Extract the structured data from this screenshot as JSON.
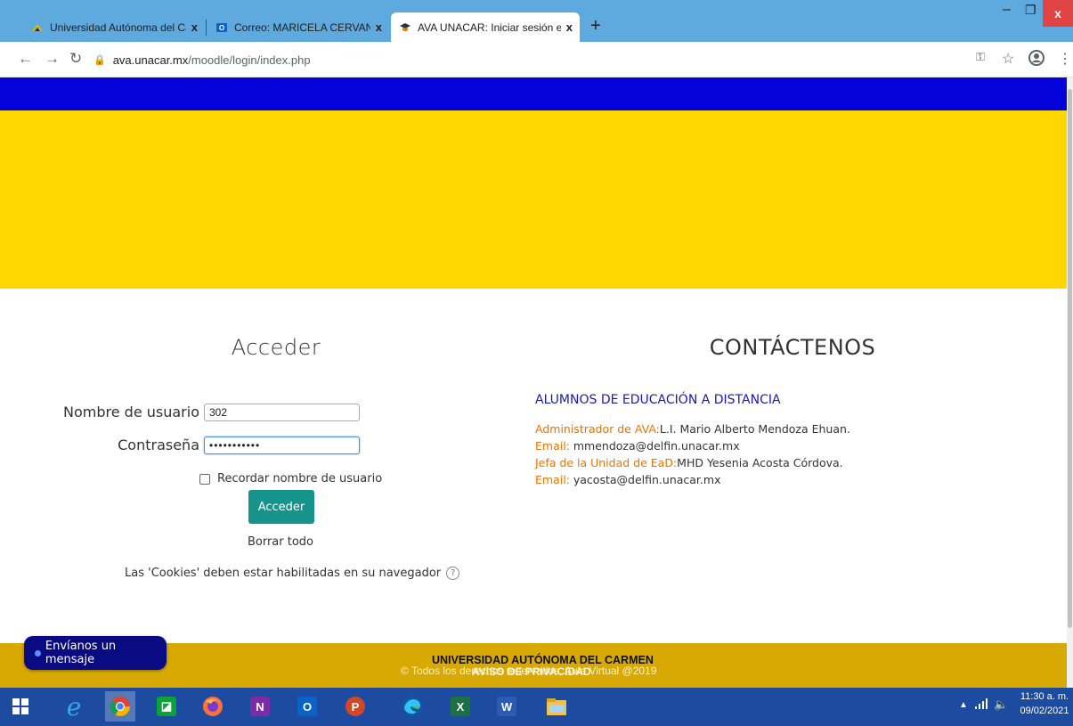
{
  "browser": {
    "tabs": [
      {
        "title": "Universidad Autónoma del Carm",
        "icon": "unacar-favicon-icon",
        "active": false
      },
      {
        "title": "Correo: MARICELA CERVANTES E",
        "icon": "outlook-favicon-icon",
        "active": false
      },
      {
        "title": "AVA UNACAR: Iniciar sesión en e",
        "icon": "moodle-favicon-icon",
        "active": true
      }
    ],
    "new_tab": "+",
    "tab_close": "x",
    "url_host": "ava.unacar.mx",
    "url_path": "/moodle/login/index.php",
    "controls": {
      "minimize": "–",
      "maximize": "❐",
      "close": "x"
    }
  },
  "login": {
    "heading": "Acceder",
    "username_label": "Nombre de usuario",
    "username_value": "302",
    "password_label": "Contraseña",
    "password_value": "•••••••••••",
    "remember_label": "Recordar nombre de usuario",
    "submit_label": "Acceder",
    "clear_label": "Borrar todo",
    "cookies_notice": "Las 'Cookies' deben estar habilitadas en su navegador",
    "help_glyph": "?"
  },
  "contact": {
    "heading": "CONTÁCTENOS",
    "subheading": "ALUMNOS DE EDUCACIÓN A DISTANCIA",
    "admin_label": "Administrador de AVA:",
    "admin_name": "L.I. Mario Alberto Mendoza Ehuan.",
    "admin_email_label": "Email:",
    "admin_email": " mmendoza@delfin.unacar.mx",
    "head_label": "Jefa de la Unidad de EaD:",
    "head_name": "MHD Yesenia Acosta Córdova.",
    "head_email_label": "Email:",
    "head_email": " yacosta@delfin.unacar.mx"
  },
  "footer": {
    "university": "UNIVERSIDAD AUTÓNOMA DEL CARMEN",
    "copyright": "© Todos los derechos reservados. Aula Virtual @2019",
    "privacy": "AVISO DE PRIVACIDAD",
    "message_button": "Envíanos un mensaje"
  },
  "taskbar": {
    "apps": [
      "windows-start-icon",
      "internet-explorer-icon",
      "chrome-icon",
      "store-icon",
      "firefox-icon",
      "onenote-icon",
      "outlook-icon",
      "powerpoint-icon",
      "edge-icon",
      "excel-icon",
      "word-icon",
      "file-explorer-icon"
    ],
    "time": "11:30 a. m.",
    "date": "09/02/2021"
  },
  "colors": {
    "header_blue": "#0202d9",
    "header_yellow": "#fed800",
    "footer_gold": "#d8a902",
    "button_teal": "#16938a",
    "label_orange": "#f07300"
  }
}
